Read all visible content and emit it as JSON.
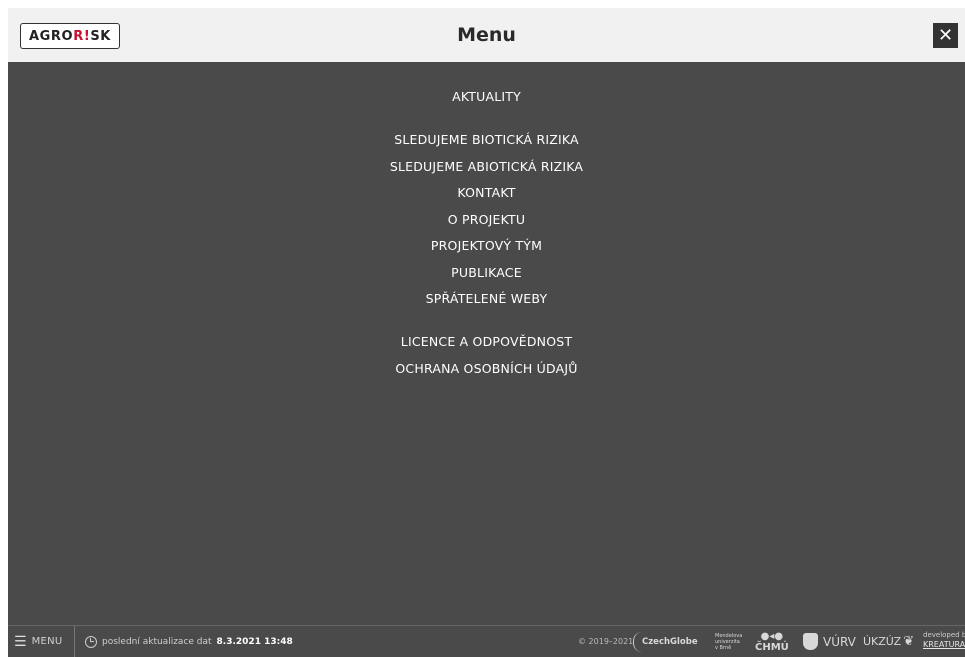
{
  "header": {
    "logo_left": "AGRO",
    "logo_accent": "R!",
    "logo_right": "SK",
    "title": "Menu",
    "close_glyph": "✕"
  },
  "menu": {
    "group1": [
      "AKTUALITY"
    ],
    "group2": [
      "SLEDUJEME BIOTICKÁ RIZIKA",
      "SLEDUJEME ABIOTICKÁ RIZIKA",
      "KONTAKT",
      "O PROJEKTU",
      "PROJEKTOVÝ TÝM",
      "PUBLIKACE",
      "SPŘÁTELENÉ WEBY"
    ],
    "group3": [
      "LICENCE A ODPOVĚDNOST",
      "OCHRANA OSOBNÍCH ÚDAJŮ"
    ]
  },
  "footer": {
    "menu_label": "MENU",
    "update_label": "poslední aktualizace dat",
    "update_value": "8.3.2021 13:48",
    "copyright": "© 2019–2021",
    "partners": {
      "czechglobe": "CzechGlobe",
      "mendelu": [
        "Mendelova",
        "univerzita",
        "v Brně"
      ],
      "chmu": "ČHMÚ",
      "vurv": "VÚRV",
      "ukzuz": "ÚKZÚZ"
    },
    "developed_by": "developed by",
    "developer": "KREATURA"
  },
  "colors": {
    "background": "#4a4a4a",
    "header": "#f1f1f1",
    "brand_accent": "#c8102e"
  }
}
